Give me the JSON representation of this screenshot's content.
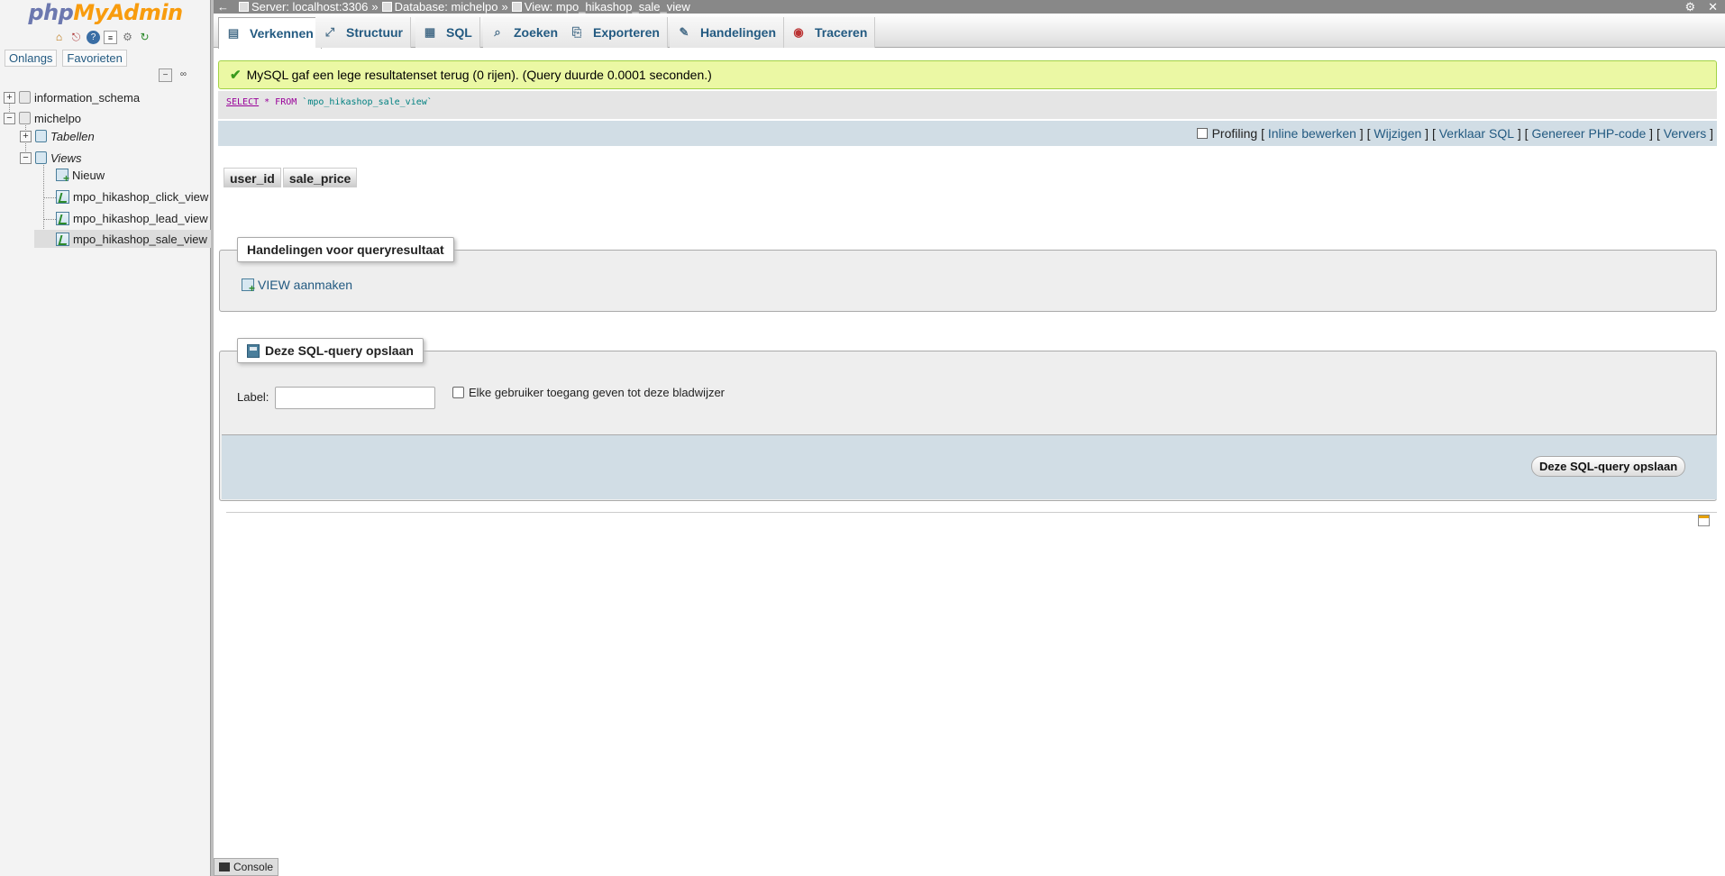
{
  "sidebar": {
    "logo_php": "php",
    "logo_myadmin": "MyAdmin",
    "quick_icons": [
      "home-icon",
      "logout-icon",
      "help-icon",
      "docs-icon",
      "settings-icon",
      "reload-icon"
    ],
    "nav_tabs": [
      "Onlangs",
      "Favorieten"
    ],
    "tree": {
      "db1": "information_schema",
      "db2": "michelpo",
      "tables": "Tabellen",
      "views": "Views",
      "new": "Nieuw",
      "view1": "mpo_hikashop_click_view",
      "view2": "mpo_hikashop_lead_view",
      "view3": "mpo_hikashop_sale_view"
    }
  },
  "topbar": {
    "back": "←",
    "server": "Server: localhost:3306",
    "sep": "»",
    "database": "Database: michelpo",
    "view": "View: mpo_hikashop_sale_view"
  },
  "menu": {
    "tabs": [
      "Verkennen",
      "Structuur",
      "SQL",
      "Zoeken",
      "Exporteren",
      "Handelingen",
      "Traceren"
    ]
  },
  "result": {
    "message": "MySQL gaf een lege resultatenset terug (0 rijen). (Query duurde 0.0001 seconden.)",
    "sql_select": "SELECT",
    "sql_star_from": " * FROM ",
    "sql_table": "`mpo_hikashop_sale_view`"
  },
  "options": {
    "profiling": "Profiling",
    "inline_edit": "Inline bewerken",
    "edit": "Wijzigen",
    "explain": "Verklaar SQL",
    "php_code": "Genereer PHP-code",
    "refresh": "Ververs"
  },
  "columns": [
    "user_id",
    "sale_price"
  ],
  "operations": {
    "legend": "Handelingen voor queryresultaat",
    "create_view": "VIEW aanmaken"
  },
  "bookmark": {
    "legend": "Deze SQL-query opslaan",
    "label": "Label:",
    "label_value": "",
    "share": "Elke gebruiker toegang geven tot deze bladwijzer",
    "save_button": "Deze SQL-query opslaan"
  },
  "console": {
    "label": "Console"
  }
}
